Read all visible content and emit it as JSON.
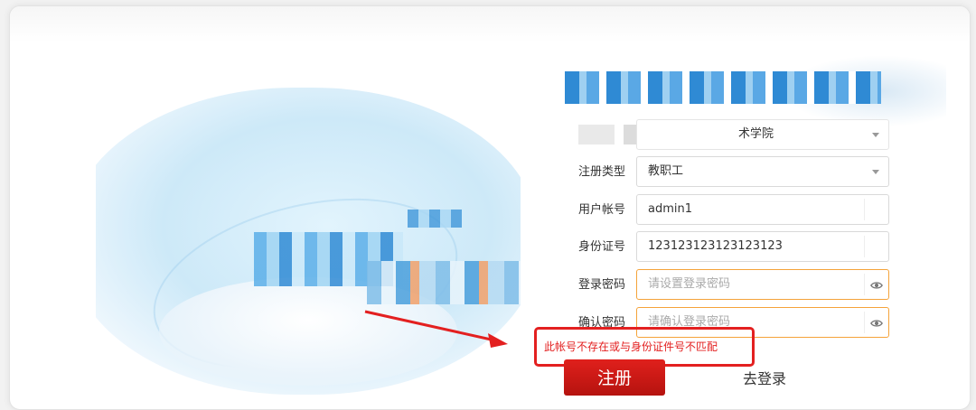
{
  "form": {
    "school": {
      "value": "术学院"
    },
    "register_type": {
      "label": "注册类型",
      "value": "教职工"
    },
    "account": {
      "label": "用户帐号",
      "value": "admin1"
    },
    "id_number": {
      "label": "身份证号",
      "value": "123123123123123123"
    },
    "password": {
      "label": "登录密码",
      "placeholder": "请设置登录密码"
    },
    "confirm_password": {
      "label": "确认密码",
      "placeholder": "请确认登录密码"
    }
  },
  "error_message": "此帐号不存在或与身份证件号不匹配",
  "actions": {
    "register": "注册",
    "go_login": "去登录"
  },
  "colors": {
    "accent": "#d0191a",
    "error": "#e32020",
    "focus_border": "#f5a33a"
  }
}
